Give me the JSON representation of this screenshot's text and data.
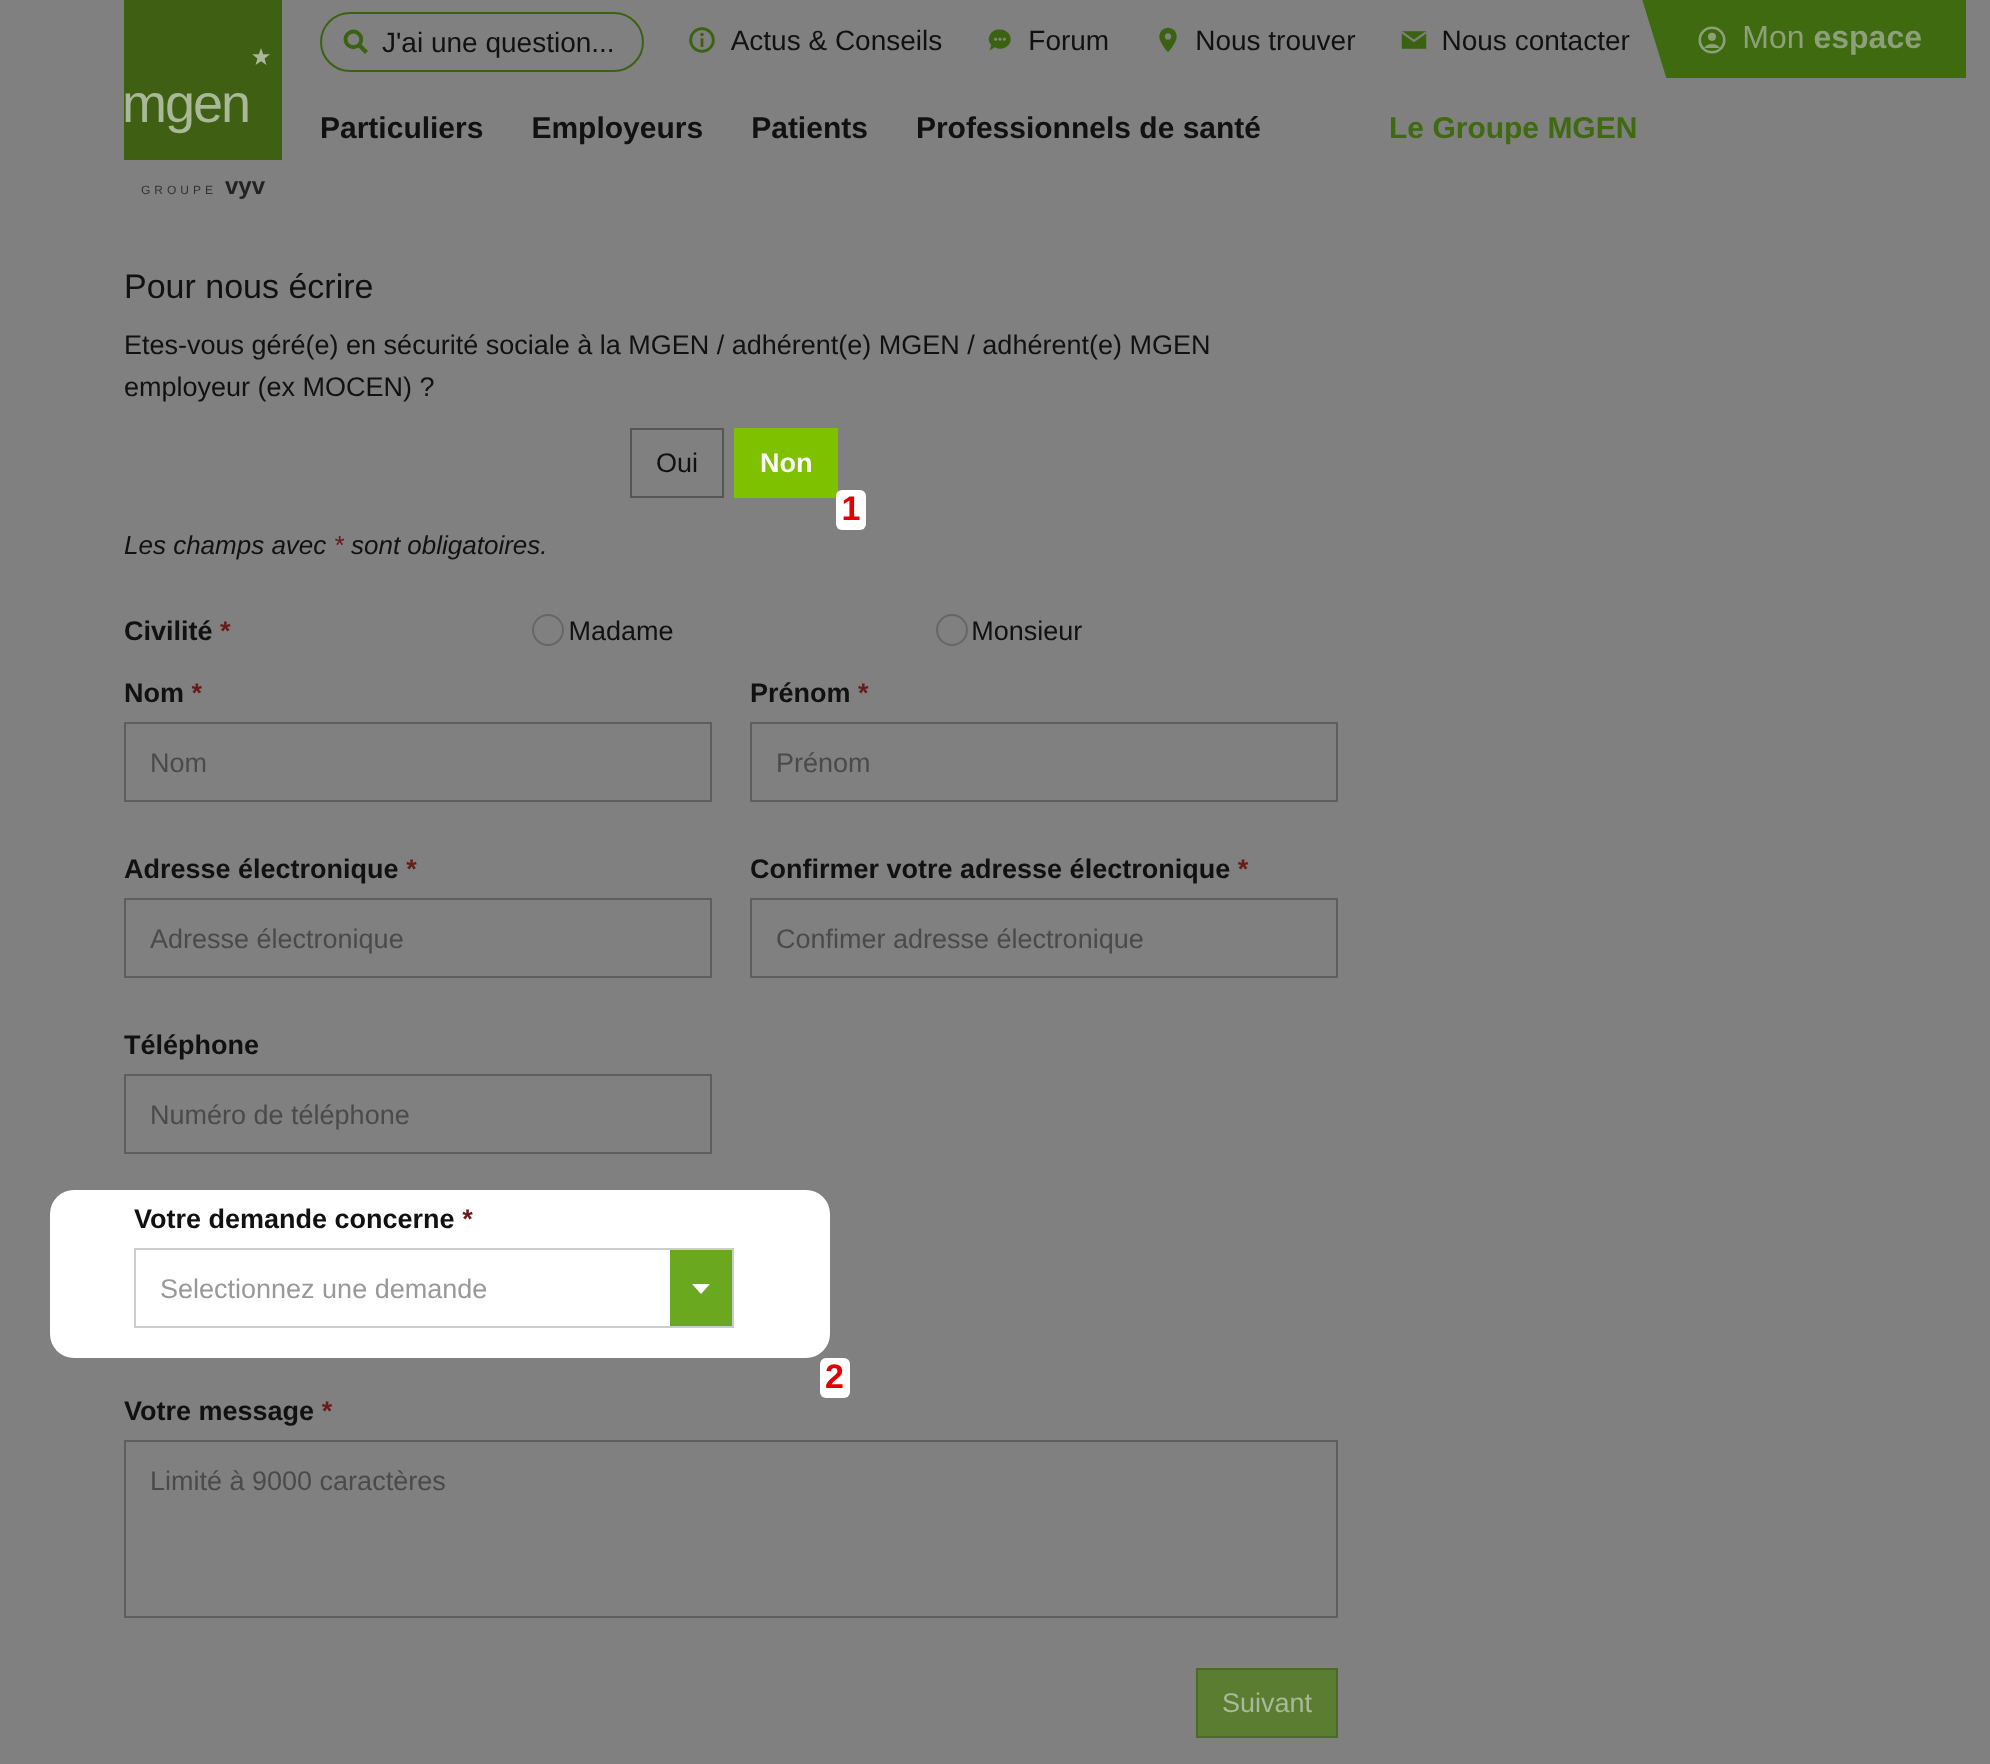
{
  "header": {
    "logo": {
      "text": "mgen",
      "group": "GROUPE",
      "brand": "vyv"
    },
    "search_button": "J'ai une question...",
    "top_links": [
      {
        "label": "Actus & Conseils",
        "kind": "info"
      },
      {
        "label": "Forum",
        "kind": "chat"
      },
      {
        "label": "Nous trouver",
        "kind": "pin"
      },
      {
        "label": "Nous contacter",
        "kind": "mail"
      }
    ],
    "account_button": "Mon **espace**",
    "nav": [
      {
        "label": "Particuliers",
        "kind": "main"
      },
      {
        "label": "Employeurs",
        "kind": "main"
      },
      {
        "label": "Patients",
        "kind": "main"
      },
      {
        "label": "Professionnels de santé",
        "kind": "main"
      },
      {
        "label": "Le Groupe MGEN",
        "kind": "group"
      }
    ]
  },
  "form": {
    "title": "Pour nous écrire",
    "question": "Etes-vous géré(e) en sécurité sociale à la MGEN / adhérent(e) MGEN / adhérent(e) MGEN employeur (ex MOCEN) ?",
    "toggle": {
      "options": [
        {
          "label": "Oui",
          "selected": false
        },
        {
          "label": "Non",
          "selected": true
        }
      ],
      "callout": "1"
    },
    "required_note": {
      "before": "Les champs avec",
      "mark": "*",
      "after": "sont obligatoires."
    },
    "civility": {
      "label": "Civilité",
      "required": true,
      "options": [
        {
          "label": "Madame",
          "selected": false
        },
        {
          "label": "Monsieur",
          "selected": false
        }
      ]
    },
    "field_rows": [
      [
        {
          "label": "Nom",
          "required": true,
          "placeholder": "Nom"
        },
        {
          "label": "Prénom",
          "required": true,
          "placeholder": "Prénom"
        }
      ],
      [
        {
          "label": "Adresse électronique",
          "required": true,
          "placeholder": "Adresse électronique"
        },
        {
          "label": "Confirmer votre adresse électronique",
          "required": true,
          "placeholder": "Confimer adresse électronique"
        }
      ],
      [
        {
          "label": "Téléphone",
          "required": false,
          "placeholder": "Numéro de téléphone"
        }
      ]
    ],
    "request": {
      "label": "Votre demande concerne",
      "required": true,
      "placeholder": "Selectionnez une demande",
      "highlighted": true,
      "callout": "2"
    },
    "message": {
      "label": "Votre message",
      "required": true,
      "placeholder": "Limité à 9000 caractères"
    },
    "submit": "Suivant"
  }
}
